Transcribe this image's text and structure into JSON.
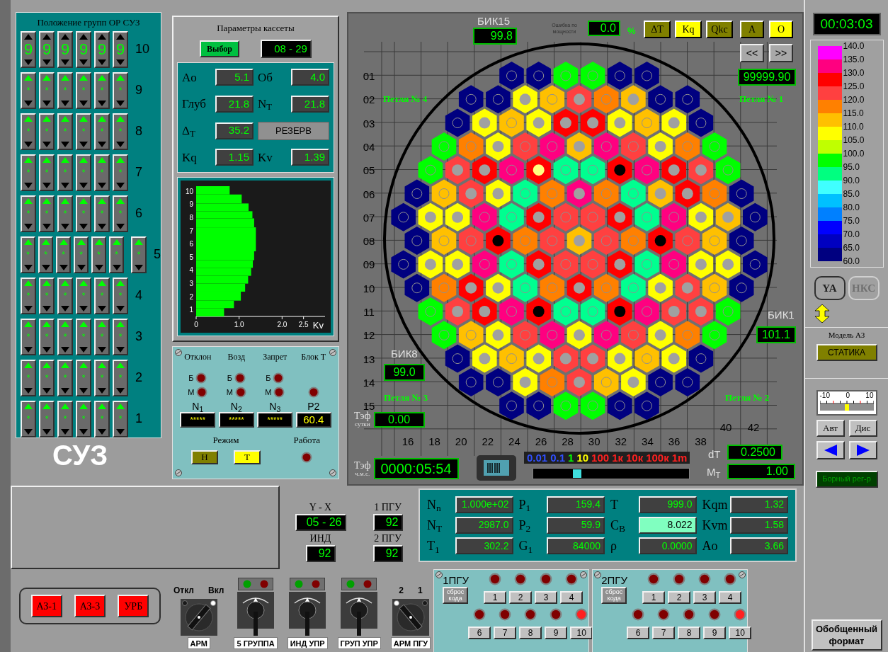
{
  "rod_groups": {
    "title": "Положение групп ОР СУЗ",
    "rows": [
      {
        "label": "10",
        "cells": [
          {
            "value": "9",
            "up": false
          },
          {
            "value": "9",
            "up": false
          },
          {
            "value": "9",
            "up": false
          },
          {
            "value": "9",
            "up": false
          },
          {
            "value": "9",
            "up": false
          },
          {
            "value": "9",
            "up": false
          }
        ]
      },
      {
        "label": "9",
        "cells": [
          {
            "value": "*",
            "up": true
          },
          {
            "value": "*",
            "up": true
          },
          {
            "value": "*",
            "up": true
          },
          {
            "value": "*",
            "up": true
          },
          {
            "value": "*",
            "up": true
          },
          {
            "value": "*",
            "up": true
          }
        ]
      },
      {
        "label": "8",
        "cells": [
          {
            "value": "*",
            "up": true
          },
          {
            "value": "*",
            "up": true
          },
          {
            "value": "*",
            "up": true
          },
          {
            "value": "*",
            "up": true
          },
          {
            "value": "*",
            "up": true
          },
          {
            "value": "*",
            "up": true
          }
        ]
      },
      {
        "label": "7",
        "cells": [
          {
            "value": "*",
            "up": true
          },
          {
            "value": "*",
            "up": true
          },
          {
            "value": "*",
            "up": true
          },
          {
            "value": "*",
            "up": true
          },
          {
            "value": "*",
            "up": true
          },
          {
            "value": "*",
            "up": true
          }
        ]
      },
      {
        "label": "6",
        "cells": [
          {
            "value": "*",
            "up": true
          },
          {
            "value": "*",
            "up": true
          },
          {
            "value": "*",
            "up": true
          },
          {
            "value": "*",
            "up": true
          },
          {
            "value": "*",
            "up": true
          },
          {
            "value": "*",
            "up": true
          }
        ]
      },
      {
        "label": "5",
        "cells": [
          {
            "value": "*",
            "up": true
          },
          {
            "value": "*",
            "up": true
          },
          {
            "value": "*",
            "up": true
          },
          {
            "value": "*",
            "up": true
          },
          {
            "value": "*",
            "up": true
          },
          {
            "value": "*",
            "up": true
          }
        ],
        "extra": {
          "value": "*",
          "up": true
        }
      },
      {
        "label": "4",
        "cells": [
          {
            "value": "*",
            "up": true
          },
          {
            "value": "*",
            "up": true
          },
          {
            "value": "*",
            "up": true
          },
          {
            "value": "*",
            "up": true
          },
          {
            "value": "*",
            "up": true
          },
          {
            "value": "*",
            "up": true
          }
        ]
      },
      {
        "label": "3",
        "cells": [
          {
            "value": "*",
            "up": true
          },
          {
            "value": "*",
            "up": true
          },
          {
            "value": "*",
            "up": true
          },
          {
            "value": "*",
            "up": true
          },
          {
            "value": "*",
            "up": true
          },
          {
            "value": "*",
            "up": true
          }
        ]
      },
      {
        "label": "2",
        "cells": [
          {
            "value": "*",
            "up": true
          },
          {
            "value": "*",
            "up": true
          },
          {
            "value": "*",
            "up": true
          },
          {
            "value": "*",
            "up": true
          },
          {
            "value": "*",
            "up": true
          },
          {
            "value": "*",
            "up": true
          }
        ]
      },
      {
        "label": "1",
        "cells": [
          {
            "value": "*",
            "up": true
          },
          {
            "value": "*",
            "up": true
          },
          {
            "value": "*",
            "up": true
          },
          {
            "value": "*",
            "up": true
          },
          {
            "value": "*",
            "up": true
          },
          {
            "value": "*",
            "up": true
          }
        ]
      }
    ]
  },
  "suz_label": "СУЗ",
  "cassette": {
    "title": "Параметры кассеты",
    "select_button": "Выбор",
    "id": "08 - 29",
    "params": [
      {
        "kind": "field",
        "label": "Ao",
        "value": "5.1"
      },
      {
        "kind": "field",
        "label": "Об",
        "value": "4.0"
      },
      {
        "kind": "field",
        "label": "Глуб",
        "value": "21.8"
      },
      {
        "kind": "field",
        "label": "N$_{T}$",
        "value": "21.8"
      },
      {
        "kind": "field",
        "label": "Δ$_{T}$",
        "value": "35.2"
      },
      {
        "kind": "button",
        "label": "РЕЗЕРВ"
      },
      {
        "kind": "field",
        "label": "Kq",
        "value": "1.15"
      },
      {
        "kind": "field",
        "label": "Kv",
        "value": "1.39"
      }
    ]
  },
  "profile": {
    "chart_data": {
      "type": "bar",
      "orientation": "horizontal",
      "xlabel": "Kv",
      "xlim": [
        0,
        3
      ],
      "ylim": [
        0.48,
        10.36
      ],
      "xticks": [
        {
          "value": 0,
          "label": "0"
        },
        {
          "value": 1,
          "label": "1.0"
        },
        {
          "value": 2,
          "label": "2.0"
        },
        {
          "value": 2.5,
          "label": "2.5"
        }
      ],
      "yticks": [
        1,
        2,
        3,
        4,
        5,
        6,
        7,
        8,
        9,
        10
      ],
      "x": [
        0.795,
        1.395,
        2.02,
        2.665,
        3.265,
        3.865,
        4.455,
        5.08,
        6.33,
        7.58,
        8.19,
        8.755,
        9.39,
        10.045
      ],
      "series": [
        {
          "color": "#00ff00",
          "values": [
            0.65,
            0.88,
            1.04,
            1.14,
            1.21,
            1.28,
            1.32,
            1.35,
            1.39,
            1.35,
            1.31,
            1.22,
            1.06,
            0.78
          ]
        }
      ]
    }
  },
  "blocking": {
    "headers": [
      "Отклон",
      "Возд",
      "Запрет",
      "Блок T"
    ],
    "big_labels": [
      "Б",
      "Б",
      "Б"
    ],
    "small_labels": [
      "М",
      "М",
      "М"
    ],
    "readouts": [
      {
        "label": "N$_{1}$",
        "value": "*****"
      },
      {
        "label": "N$_{2}$",
        "value": "*****"
      },
      {
        "label": "N$_{3}$",
        "value": "*****"
      },
      {
        "label": "P2",
        "value": "60.4"
      }
    ],
    "mode_label": "Режим",
    "modes": [
      {
        "label": "Н",
        "selected": false
      },
      {
        "label": "Т",
        "selected": true
      }
    ],
    "work_label": "Работа"
  },
  "core": {
    "bik15": {
      "label": "БИК15",
      "value": "99.8"
    },
    "power_error": {
      "label": "Ошибка по мощности",
      "value": "0.0",
      "unit": "%"
    },
    "modes": [
      {
        "label": "ΔT",
        "selected": false
      },
      {
        "label": "Kq",
        "selected": true
      },
      {
        "label": "Qkc",
        "selected": false
      }
    ],
    "views": [
      {
        "label": "A",
        "selected": false
      },
      {
        "label": "O",
        "selected": true
      }
    ],
    "nav": [
      "<<",
      ">>"
    ],
    "counter": "99999.90",
    "loops": [
      "Петля № 4",
      "Петля № 1",
      "Петля № 3",
      "Петля № 2"
    ],
    "bik1": {
      "label": "БИК1",
      "value": "101.1"
    },
    "bik8": {
      "label": "БИК8",
      "value": "99.0"
    },
    "teff_days": {
      "label": "Тэф",
      "sublabel": "сутки",
      "value": "0.00"
    },
    "teff_time": {
      "label": "Тэф",
      "sublabel": "ч.м.с.",
      "value": "0000:05:54"
    },
    "speed": {
      "labels": [
        {
          "text": "0.01",
          "kind": "low"
        },
        {
          "text": "0.1",
          "kind": "low"
        },
        {
          "text": "1",
          "kind": "unit"
        },
        {
          "text": "10",
          "kind": "mid"
        },
        {
          "text": "100",
          "kind": "high"
        },
        {
          "text": "1к",
          "kind": "high"
        },
        {
          "text": "10к",
          "kind": "high"
        },
        {
          "text": "100к",
          "kind": "high"
        },
        {
          "text": "1m",
          "kind": "high"
        }
      ],
      "level": 0.28
    },
    "dt": {
      "label": "dT",
      "value": "0.2500"
    },
    "mt": {
      "label": "M$_{T}$",
      "value": "1.00"
    },
    "column_labels": [
      "16",
      "18",
      "20",
      "22",
      "24",
      "26",
      "28",
      "30",
      "32",
      "34",
      "36",
      "38"
    ],
    "extra_column_labels": [
      "40",
      "42"
    ],
    "rows": [
      {
        "label": "01",
        "cells": [
          {
            "color": "#000080",
            "kind": "ring"
          },
          {
            "color": "#000080",
            "kind": "ring"
          },
          {
            "color": "#00ff00",
            "kind": "ring"
          },
          {
            "color": "#00ff00",
            "kind": "ring"
          },
          {
            "color": "#000080",
            "kind": "ring"
          },
          {
            "color": "#000080",
            "kind": "ring"
          }
        ]
      },
      {
        "label": "02",
        "cells": [
          {
            "color": "#000080",
            "kind": "ring"
          },
          {
            "color": "#000080",
            "kind": "ring"
          },
          {
            "color": "#ffff00",
            "kind": "dot"
          },
          {
            "color": "#ffc000",
            "kind": "ring"
          },
          {
            "color": "#ff4040",
            "kind": "dot"
          },
          {
            "color": "#ff8000",
            "kind": "ring"
          },
          {
            "color": "#ffc000",
            "kind": "dot"
          },
          {
            "color": "#000080",
            "kind": "ring"
          },
          {
            "color": "#000080",
            "kind": "ring"
          }
        ]
      },
      {
        "label": "03",
        "cells": [
          {
            "color": "#000080",
            "kind": "ring"
          },
          {
            "color": "#ffff00",
            "kind": "dot"
          },
          {
            "color": "#ffc000",
            "kind": "ring"
          },
          {
            "color": "#ffff00",
            "kind": "dot"
          },
          {
            "color": "#ff0000",
            "kind": "dot"
          },
          {
            "color": "#ff0000",
            "kind": "dot"
          },
          {
            "color": "#ffff00",
            "kind": "dot"
          },
          {
            "color": "#ffc000",
            "kind": "ring"
          },
          {
            "color": "#ffff00",
            "kind": "dot"
          },
          {
            "color": "#000080",
            "kind": "ring"
          }
        ]
      },
      {
        "label": "04",
        "cells": [
          {
            "color": "#00ff00",
            "kind": "ring"
          },
          {
            "color": "#ff8000",
            "kind": "ring"
          },
          {
            "color": "#ffff00",
            "kind": "dot"
          },
          {
            "color": "#ff4040",
            "kind": "ring"
          },
          {
            "color": "#ff0080",
            "kind": "ring"
          },
          {
            "color": "#ffc000",
            "kind": "dot"
          },
          {
            "color": "#ff0080",
            "kind": "ring"
          },
          {
            "color": "#ff4040",
            "kind": "ring"
          },
          {
            "color": "#ffff00",
            "kind": "dot"
          },
          {
            "color": "#ff8000",
            "kind": "ring"
          },
          {
            "color": "#00ff00",
            "kind": "ring"
          }
        ]
      },
      {
        "label": "05",
        "cells": [
          {
            "color": "#00ff00",
            "kind": "ring"
          },
          {
            "color": "#ff4040",
            "kind": "dot"
          },
          {
            "color": "#ff0000",
            "kind": "dot"
          },
          {
            "color": "#ff0080",
            "kind": "ring"
          },
          {
            "color": "#ff0000",
            "kind": "light"
          },
          {
            "color": "#00ff90",
            "kind": "ring"
          },
          {
            "color": "#00ff90",
            "kind": "ring"
          },
          {
            "color": "#ff0000",
            "kind": "black"
          },
          {
            "color": "#ff0080",
            "kind": "ring"
          },
          {
            "color": "#ff0000",
            "kind": "dot"
          },
          {
            "color": "#ff4040",
            "kind": "dot"
          },
          {
            "color": "#00ff00",
            "kind": "ring"
          }
        ]
      },
      {
        "label": "06",
        "cells": [
          {
            "color": "#000080",
            "kind": "ring"
          },
          {
            "color": "#ffc000",
            "kind": "ring"
          },
          {
            "color": "#ff4040",
            "kind": "dot"
          },
          {
            "color": "#ffff00",
            "kind": "dot"
          },
          {
            "color": "#00ff90",
            "kind": "ring"
          },
          {
            "color": "#ff8000",
            "kind": "ring"
          },
          {
            "color": "#ff0080",
            "kind": "dot"
          },
          {
            "color": "#ff8000",
            "kind": "ring"
          },
          {
            "color": "#00ff90",
            "kind": "ring"
          },
          {
            "color": "#ffc000",
            "kind": "dot"
          },
          {
            "color": "#ff0000",
            "kind": "dot"
          },
          {
            "color": "#ff8000",
            "kind": "ring"
          },
          {
            "color": "#000080",
            "kind": "ring"
          }
        ]
      },
      {
        "label": "07",
        "cells": [
          {
            "color": "#000080",
            "kind": "ring"
          },
          {
            "color": "#ffff00",
            "kind": "dot"
          },
          {
            "color": "#ffff00",
            "kind": "dot"
          },
          {
            "color": "#ff0080",
            "kind": "ring"
          },
          {
            "color": "#00ff90",
            "kind": "ring"
          },
          {
            "color": "#ff0000",
            "kind": "dot"
          },
          {
            "color": "#ff4040",
            "kind": "ring"
          },
          {
            "color": "#ff4040",
            "kind": "ring"
          },
          {
            "color": "#ff0000",
            "kind": "dot"
          },
          {
            "color": "#00ff90",
            "kind": "ring"
          },
          {
            "color": "#ff0080",
            "kind": "ring"
          },
          {
            "color": "#ffff00",
            "kind": "dot"
          },
          {
            "color": "#ffc000",
            "kind": "dot"
          },
          {
            "color": "#000080",
            "kind": "ring"
          }
        ]
      },
      {
        "label": "08",
        "cells": [
          {
            "color": "#000080",
            "kind": "ring"
          },
          {
            "color": "#ffc000",
            "kind": "ring"
          },
          {
            "color": "#ff4040",
            "kind": "ring"
          },
          {
            "color": "#ff0000",
            "kind": "black"
          },
          {
            "color": "#ff8000",
            "kind": "ring"
          },
          {
            "color": "#ff4040",
            "kind": "ring"
          },
          {
            "color": "#ffc000",
            "kind": "dot"
          },
          {
            "color": "#ff4040",
            "kind": "ring"
          },
          {
            "color": "#ff8000",
            "kind": "ring"
          },
          {
            "color": "#ff0000",
            "kind": "black"
          },
          {
            "color": "#ff4040",
            "kind": "ring"
          },
          {
            "color": "#ffc000",
            "kind": "ring"
          },
          {
            "color": "#000080",
            "kind": "ring"
          }
        ]
      },
      {
        "label": "09",
        "cells": [
          {
            "color": "#000080",
            "kind": "ring"
          },
          {
            "color": "#ffff00",
            "kind": "dot"
          },
          {
            "color": "#ffff00",
            "kind": "dot"
          },
          {
            "color": "#ff0080",
            "kind": "ring"
          },
          {
            "color": "#00ff90",
            "kind": "ring"
          },
          {
            "color": "#ff0000",
            "kind": "dot"
          },
          {
            "color": "#ff4040",
            "kind": "ring"
          },
          {
            "color": "#ff4040",
            "kind": "ring"
          },
          {
            "color": "#ff0000",
            "kind": "dot"
          },
          {
            "color": "#00ff90",
            "kind": "ring"
          },
          {
            "color": "#ff0080",
            "kind": "ring"
          },
          {
            "color": "#ffff00",
            "kind": "dot"
          },
          {
            "color": "#ffff00",
            "kind": "dot"
          },
          {
            "color": "#000080",
            "kind": "ring"
          }
        ]
      },
      {
        "label": "10",
        "cells": [
          {
            "color": "#000080",
            "kind": "ring"
          },
          {
            "color": "#ff8000",
            "kind": "ring"
          },
          {
            "color": "#ff0000",
            "kind": "dot"
          },
          {
            "color": "#ffff00",
            "kind": "dot"
          },
          {
            "color": "#00ff90",
            "kind": "ring"
          },
          {
            "color": "#ff8000",
            "kind": "ring"
          },
          {
            "color": "#ff0000",
            "kind": "dot"
          },
          {
            "color": "#ff8000",
            "kind": "ring"
          },
          {
            "color": "#00ff90",
            "kind": "ring"
          },
          {
            "color": "#ffff00",
            "kind": "dot"
          },
          {
            "color": "#ff4040",
            "kind": "dot"
          },
          {
            "color": "#ffc000",
            "kind": "ring"
          },
          {
            "color": "#000080",
            "kind": "ring"
          }
        ]
      },
      {
        "label": "11",
        "cells": [
          {
            "color": "#00ff00",
            "kind": "ring"
          },
          {
            "color": "#ff4040",
            "kind": "dot"
          },
          {
            "color": "#ff0000",
            "kind": "dot"
          },
          {
            "color": "#ff0080",
            "kind": "ring"
          },
          {
            "color": "#ff0000",
            "kind": "black"
          },
          {
            "color": "#00ff90",
            "kind": "ring"
          },
          {
            "color": "#00ff90",
            "kind": "ring"
          },
          {
            "color": "#ff0000",
            "kind": "black"
          },
          {
            "color": "#ff0080",
            "kind": "ring"
          },
          {
            "color": "#ff4040",
            "kind": "dot"
          },
          {
            "color": "#ff4040",
            "kind": "dot"
          },
          {
            "color": "#00ff00",
            "kind": "ring"
          }
        ]
      },
      {
        "label": "12",
        "cells": [
          {
            "color": "#00ff00",
            "kind": "ring"
          },
          {
            "color": "#ffc000",
            "kind": "ring"
          },
          {
            "color": "#ffff00",
            "kind": "dot"
          },
          {
            "color": "#ff4040",
            "kind": "ring"
          },
          {
            "color": "#ff0080",
            "kind": "ring"
          },
          {
            "color": "#ffff00",
            "kind": "dot"
          },
          {
            "color": "#ff0080",
            "kind": "ring"
          },
          {
            "color": "#ff4040",
            "kind": "ring"
          },
          {
            "color": "#ffff00",
            "kind": "dot"
          },
          {
            "color": "#ff8000",
            "kind": "ring"
          },
          {
            "color": "#00ff00",
            "kind": "ring"
          }
        ]
      },
      {
        "label": "13",
        "cells": [
          {
            "color": "#000080",
            "kind": "ring"
          },
          {
            "color": "#ffff00",
            "kind": "dot"
          },
          {
            "color": "#ffc000",
            "kind": "ring"
          },
          {
            "color": "#ffff00",
            "kind": "dot"
          },
          {
            "color": "#ff4040",
            "kind": "dot"
          },
          {
            "color": "#ff4040",
            "kind": "dot"
          },
          {
            "color": "#ffff00",
            "kind": "dot"
          },
          {
            "color": "#ffc000",
            "kind": "ring"
          },
          {
            "color": "#ffff00",
            "kind": "dot"
          },
          {
            "color": "#000080",
            "kind": "ring"
          }
        ]
      },
      {
        "label": "14",
        "cells": [
          {
            "color": "#000080",
            "kind": "ring"
          },
          {
            "color": "#000080",
            "kind": "ring"
          },
          {
            "color": "#ffff00",
            "kind": "dot"
          },
          {
            "color": "#ff8000",
            "kind": "ring"
          },
          {
            "color": "#ff4040",
            "kind": "dot"
          },
          {
            "color": "#ffc000",
            "kind": "ring"
          },
          {
            "color": "#ffff00",
            "kind": "dot"
          },
          {
            "color": "#000080",
            "kind": "ring"
          },
          {
            "color": "#000080",
            "kind": "ring"
          }
        ]
      },
      {
        "label": "15",
        "cells": [
          {
            "color": "#000080",
            "kind": "ring"
          },
          {
            "color": "#000080",
            "kind": "ring"
          },
          {
            "color": "#00ff00",
            "kind": "ring"
          },
          {
            "color": "#00ff00",
            "kind": "ring"
          },
          {
            "color": "#000080",
            "kind": "ring"
          },
          {
            "color": "#000080",
            "kind": "ring"
          }
        ]
      }
    ]
  },
  "side": {
    "clock": "00:03:03",
    "legend": {
      "swatches": [
        {
          "color": "#ff00ff"
        },
        {
          "color": "#ff0080"
        },
        {
          "color": "#ff0000"
        },
        {
          "color": "#ff4040"
        },
        {
          "color": "#ff8000"
        },
        {
          "color": "#ffc000"
        },
        {
          "color": "#ffff00"
        },
        {
          "color": "#c0ff00"
        },
        {
          "color": "#00ff00"
        },
        {
          "color": "#00ff80"
        },
        {
          "color": "#40ffff"
        },
        {
          "color": "#00c0ff"
        },
        {
          "color": "#0080ff"
        },
        {
          "color": "#0000ff"
        },
        {
          "color": "#0000c0"
        },
        {
          "color": "#000080"
        }
      ],
      "labels": [
        "140.0",
        "135.0",
        "130.0",
        "125.0",
        "120.0",
        "115.0",
        "110.0",
        "105.0",
        "100.0",
        "95.0",
        "90.0",
        "85.0",
        "80.0",
        "75.0",
        "70.0",
        "65.0",
        "60.0"
      ]
    },
    "sources": [
      {
        "label": "YA",
        "selected": true
      },
      {
        "label": "НКС",
        "selected": false
      }
    ],
    "model_label": "Модель АЗ",
    "model_button": "СТАТИКА",
    "gauge": {
      "labels": [
        "-10",
        "0",
        "10"
      ],
      "level": 0.5
    },
    "auto_buttons": [
      "Авт",
      "Дис"
    ],
    "boron_button": "Борный рег-р",
    "format_button": "Обобщенный формат"
  },
  "bottom": {
    "scram_buttons": [
      "АЗ-1",
      "АЗ-3",
      "УРБ"
    ],
    "switches": [
      {
        "kind": "rotary",
        "label": "АРМ",
        "positions": [
          {
            "label": "Откл",
            "selected": false
          },
          {
            "label": "Вкл",
            "selected": true
          }
        ]
      },
      {
        "kind": "lever",
        "label": "5 ГРУППА",
        "on": false,
        "lamps": [
          {
            "color": "#00a000"
          },
          {
            "color": "#800000"
          }
        ]
      },
      {
        "kind": "lever",
        "label": "ИНД УПР",
        "on": false,
        "lamps": [
          {
            "color": "#00a000"
          },
          {
            "color": "#800000"
          }
        ]
      },
      {
        "kind": "lever",
        "label": "ГРУП УПР",
        "on": false,
        "lamps": [
          {
            "color": "#00a000"
          },
          {
            "color": "#800000"
          }
        ]
      },
      {
        "kind": "rotary",
        "label": "АРМ ПГУ",
        "positions": [
          {
            "label": "2",
            "selected": true
          },
          {
            "label": "1",
            "selected": false
          }
        ]
      }
    ],
    "indicators": [
      {
        "label": "Y - X",
        "value": "05 - 26"
      },
      {
        "label": "1 ПГУ",
        "value": "92"
      },
      {
        "label": "ИНД",
        "value": "92"
      },
      {
        "label": "2 ПГУ",
        "value": "92"
      }
    ],
    "params": [
      {
        "label": "N$_{n}$",
        "value": "1.000e+02",
        "highlighted": false
      },
      {
        "label": "P$_{1}$",
        "value": "159.4",
        "highlighted": false
      },
      {
        "label": "T",
        "value": "999.0",
        "highlighted": false
      },
      {
        "label": "Kqm",
        "value": "1.32",
        "highlighted": false
      },
      {
        "label": "N$_{T}$",
        "value": "2987.0",
        "highlighted": false
      },
      {
        "label": "P$_{2}$",
        "value": "59.9",
        "highlighted": false
      },
      {
        "label": "C$_{B}$",
        "value": "8.022",
        "highlighted": true
      },
      {
        "label": "Kvm",
        "value": "1.58",
        "highlighted": false
      },
      {
        "label": "T$_{1}$",
        "value": "302.2",
        "highlighted": false
      },
      {
        "label": "G$_{1}$",
        "value": "84000",
        "highlighted": false
      },
      {
        "label": "ρ",
        "value": "0.0000",
        "highlighted": false
      },
      {
        "label": "Ao",
        "value": "3.66",
        "highlighted": false
      }
    ],
    "pgu": [
      {
        "title": "1ПГУ",
        "reset": "сброс кода",
        "buttons": [
          {
            "label": "1",
            "on": false
          },
          {
            "label": "2",
            "on": false
          },
          {
            "label": "3",
            "on": false
          },
          {
            "label": "4",
            "on": false
          },
          {
            "label": "6",
            "on": false
          },
          {
            "label": "7",
            "on": false
          },
          {
            "label": "8",
            "on": false
          },
          {
            "label": "9",
            "on": false
          },
          {
            "label": "10",
            "on": true
          }
        ]
      },
      {
        "title": "2ПГУ",
        "reset": "сброс кода",
        "buttons": [
          {
            "label": "1",
            "on": false
          },
          {
            "label": "2",
            "on": false
          },
          {
            "label": "3",
            "on": false
          },
          {
            "label": "4",
            "on": false
          },
          {
            "label": "6",
            "on": false
          },
          {
            "label": "7",
            "on": false
          },
          {
            "label": "8",
            "on": false
          },
          {
            "label": "9",
            "on": false
          },
          {
            "label": "10",
            "on": true
          }
        ]
      }
    ]
  }
}
